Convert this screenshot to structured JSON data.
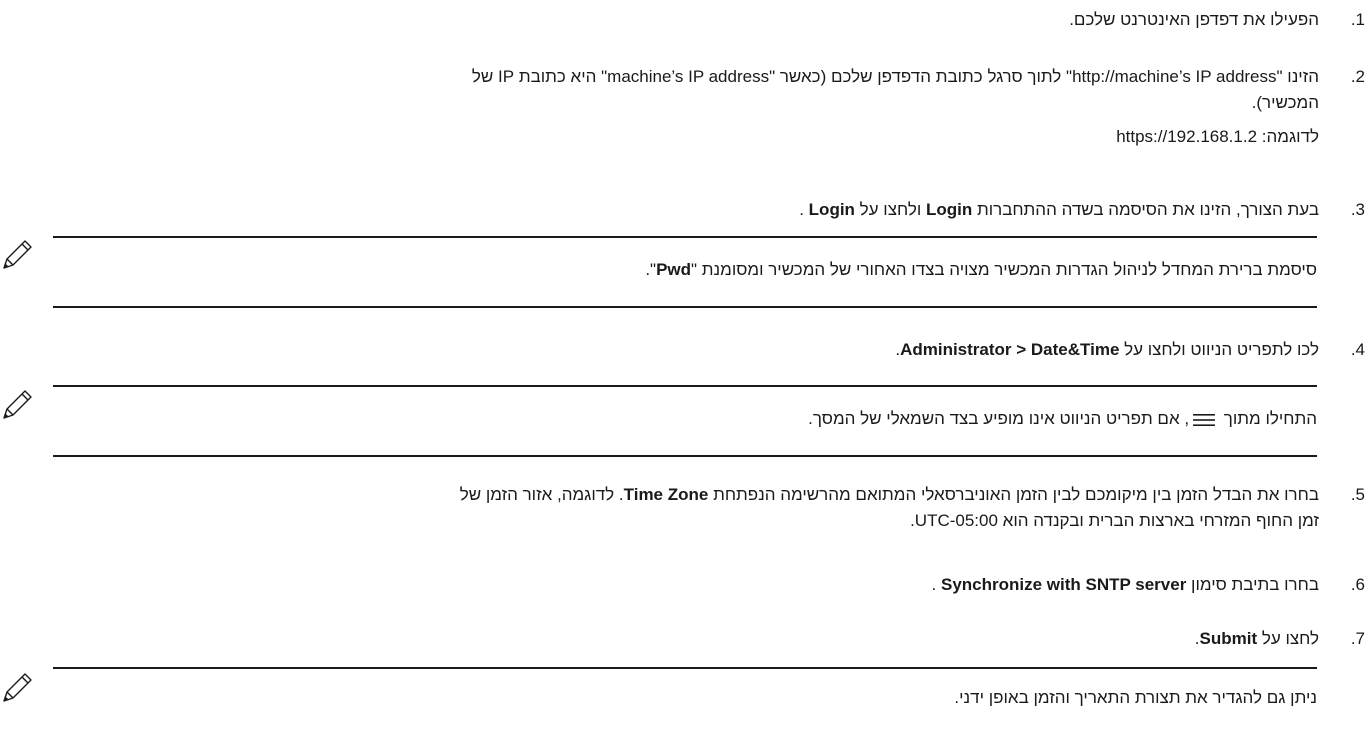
{
  "steps": [
    {
      "number": ".1",
      "text": "הפעילו את דפדפן האינטרנט שלכם."
    },
    {
      "number": ".2",
      "text_line1": "הזינו \"http://machine’s IP address\" לתוך סרגל כתובת הדפדפן שלכם (כאשר \"machine’s IP address\" היא כתובת IP של",
      "text_line2": "המכשיר).",
      "example_label": "לדוגמה:",
      "example_value": "https://192.168.1.2"
    },
    {
      "number": ".3",
      "text_a": "בעת הצורך, הזינו את הסיסמה בשדה ההתחברות ",
      "bold_a": "Login",
      "text_b": " ולחצו על ",
      "bold_b": "Login",
      "text_c": " ."
    },
    {
      "number": ".4",
      "text_a": "לכו לתפריט הניווט ולחצו על ",
      "bold_a": "Administrator > Date&Time",
      "text_b": "."
    },
    {
      "number": ".5",
      "text_a": "בחרו את הבדל הזמן בין מיקומכם לבין הזמן האוניברסאלי המתואם מהרשימה הנפתחת ",
      "bold_a": "Time Zone",
      "text_b": ". לדוגמה, אזור הזמן של",
      "text_line2": "זמן החוף המזרחי בארצות הברית ובקנדה הוא UTC-05:00."
    },
    {
      "number": ".6",
      "text_a": "בחרו בתיבת סימון ",
      "bold_a": "Synchronize with SNTP server",
      "text_b": " ."
    },
    {
      "number": ".7",
      "text_a": "לחצו על ",
      "bold_a": "Submit",
      "text_b": "."
    }
  ],
  "notes": [
    {
      "text_a": "סיסמת ברירת המחדל לניהול הגדרות המכשיר מצויה בצדו האחורי של המכשיר ומסומנת \"",
      "bold_a": "Pwd",
      "text_b": "\"."
    },
    {
      "text_a": "התחילו מתוך ",
      "icon": "hamburger-menu-icon",
      "text_b": ", אם תפריט הניווט אינו מופיע בצד השמאלי של המסך."
    },
    {
      "text": "ניתן גם להגדיר את תצורת התאריך והזמן באופן ידני."
    }
  ]
}
